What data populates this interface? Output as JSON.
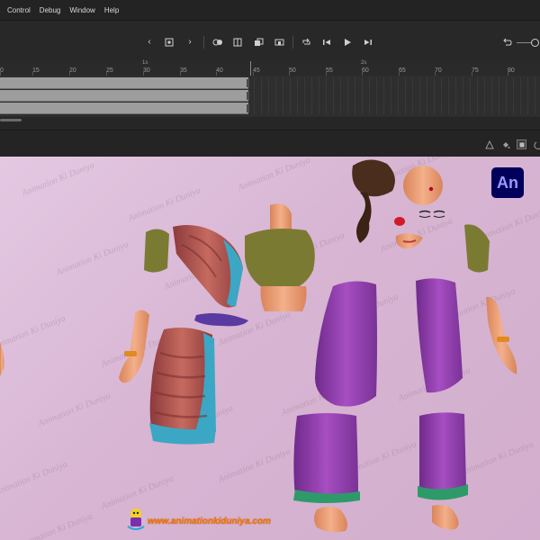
{
  "menu": {
    "items": [
      "Control",
      "Debug",
      "Window",
      "Help"
    ]
  },
  "timeline": {
    "ruler_ticks": [
      "0",
      "15",
      "20",
      "25",
      "30",
      "35",
      "40",
      "45",
      "50",
      "55",
      "60",
      "65",
      "70",
      "75",
      "80"
    ],
    "second_markers": [
      "1s",
      "2s"
    ],
    "playhead_frame": 45
  },
  "stage": {
    "watermark": "Animation Ki Duniya",
    "badge": "An",
    "site_url": "www.animationkiduniya.com"
  },
  "colors": {
    "stage_bg": "#dcbcd8",
    "purple_sari": "#8e3aa8",
    "blouse_olive": "#7b7a33",
    "sari_red": "#b9524e",
    "border_teal": "#3ba7c4",
    "skin": "#e79a6e",
    "an_badge": "#00005b"
  }
}
